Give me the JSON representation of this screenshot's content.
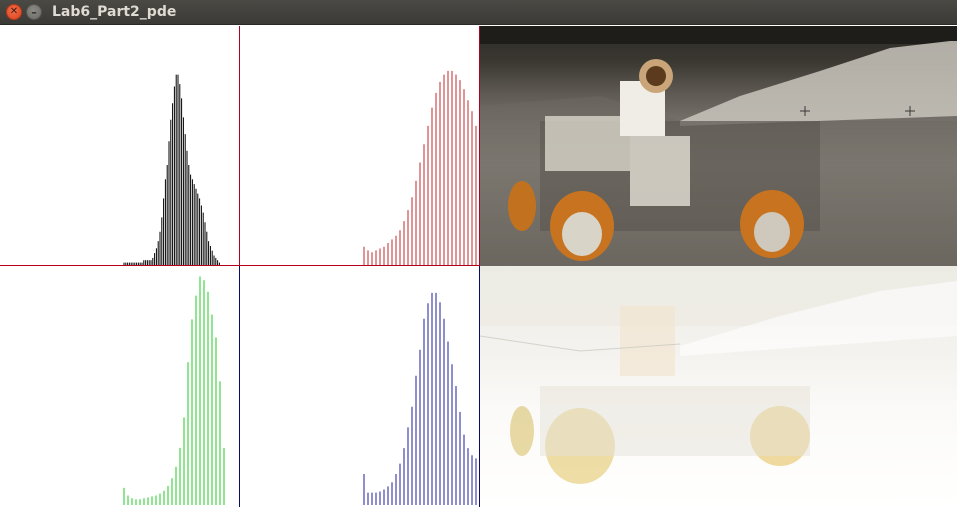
{
  "window": {
    "title": "Lab6_Part2_pde",
    "close_icon": "close-icon",
    "minimize_icon": "minimize-icon"
  },
  "colors": {
    "title_bar": "#3c3b37",
    "title_text": "#dfdbd2",
    "close_button": "#e95420",
    "background": "#ffffff",
    "gray_histogram": "#000000",
    "red_histogram": "#c0282d",
    "green_histogram": "#22cc22",
    "blue_histogram": "#1f1f9e",
    "panel_divider_top": "#b4001e",
    "panel_divider_bottom": "#0a0a6e"
  },
  "chart_data": [
    {
      "type": "bar",
      "title": "",
      "series": [
        {
          "color": "#000000",
          "values": [
            1,
            1,
            1,
            1,
            1,
            1,
            1,
            1,
            1,
            1,
            1,
            2,
            2,
            2,
            2,
            2,
            3,
            5,
            7,
            10,
            14,
            20,
            28,
            36,
            42,
            52,
            61,
            68,
            75,
            80,
            80,
            76,
            70,
            62,
            55,
            48,
            42,
            38,
            36,
            34,
            32,
            30,
            28,
            25,
            22,
            18,
            14,
            10,
            8,
            6,
            4,
            3,
            2,
            1
          ]
        }
      ],
      "x_start_bin": 40,
      "bin_width": 1,
      "ylim": [
        0,
        100
      ]
    },
    {
      "type": "bar",
      "title": "",
      "series": [
        {
          "color": "#c0282d",
          "values": [
            10,
            8,
            7,
            8,
            9,
            10,
            12,
            14,
            16,
            19,
            24,
            30,
            37,
            46,
            56,
            66,
            76,
            86,
            94,
            100,
            104,
            106,
            106,
            104,
            101,
            96,
            90,
            84,
            76,
            68,
            58,
            50
          ]
        }
      ],
      "x_start_bin": 20,
      "bin_width": 1,
      "ylim": [
        0,
        130
      ]
    },
    {
      "type": "bar",
      "title": "",
      "series": [
        {
          "color": "#22cc22",
          "values": [
            18,
            10,
            7,
            6,
            6,
            7,
            8,
            9,
            10,
            12,
            15,
            20,
            28,
            40,
            60,
            92,
            150,
            195,
            220,
            240,
            236,
            224,
            200,
            176,
            130,
            60
          ]
        }
      ],
      "x_start_bin": 20,
      "bin_width": 1,
      "ylim": [
        0,
        250
      ]
    },
    {
      "type": "bar",
      "title": "",
      "series": [
        {
          "color": "#1f1f9e",
          "values": [
            30,
            12,
            12,
            12,
            13,
            15,
            18,
            22,
            30,
            40,
            55,
            75,
            95,
            125,
            150,
            180,
            195,
            205,
            205,
            196,
            180,
            158,
            136,
            115,
            90,
            68,
            55,
            48,
            45
          ]
        }
      ],
      "x_start_bin": 20,
      "bin_width": 1,
      "ylim": [
        0,
        230
      ]
    }
  ],
  "images": {
    "original": "lunar-rover-astronaut-photo",
    "inverted": "inverted-lunar-rover-photo"
  }
}
